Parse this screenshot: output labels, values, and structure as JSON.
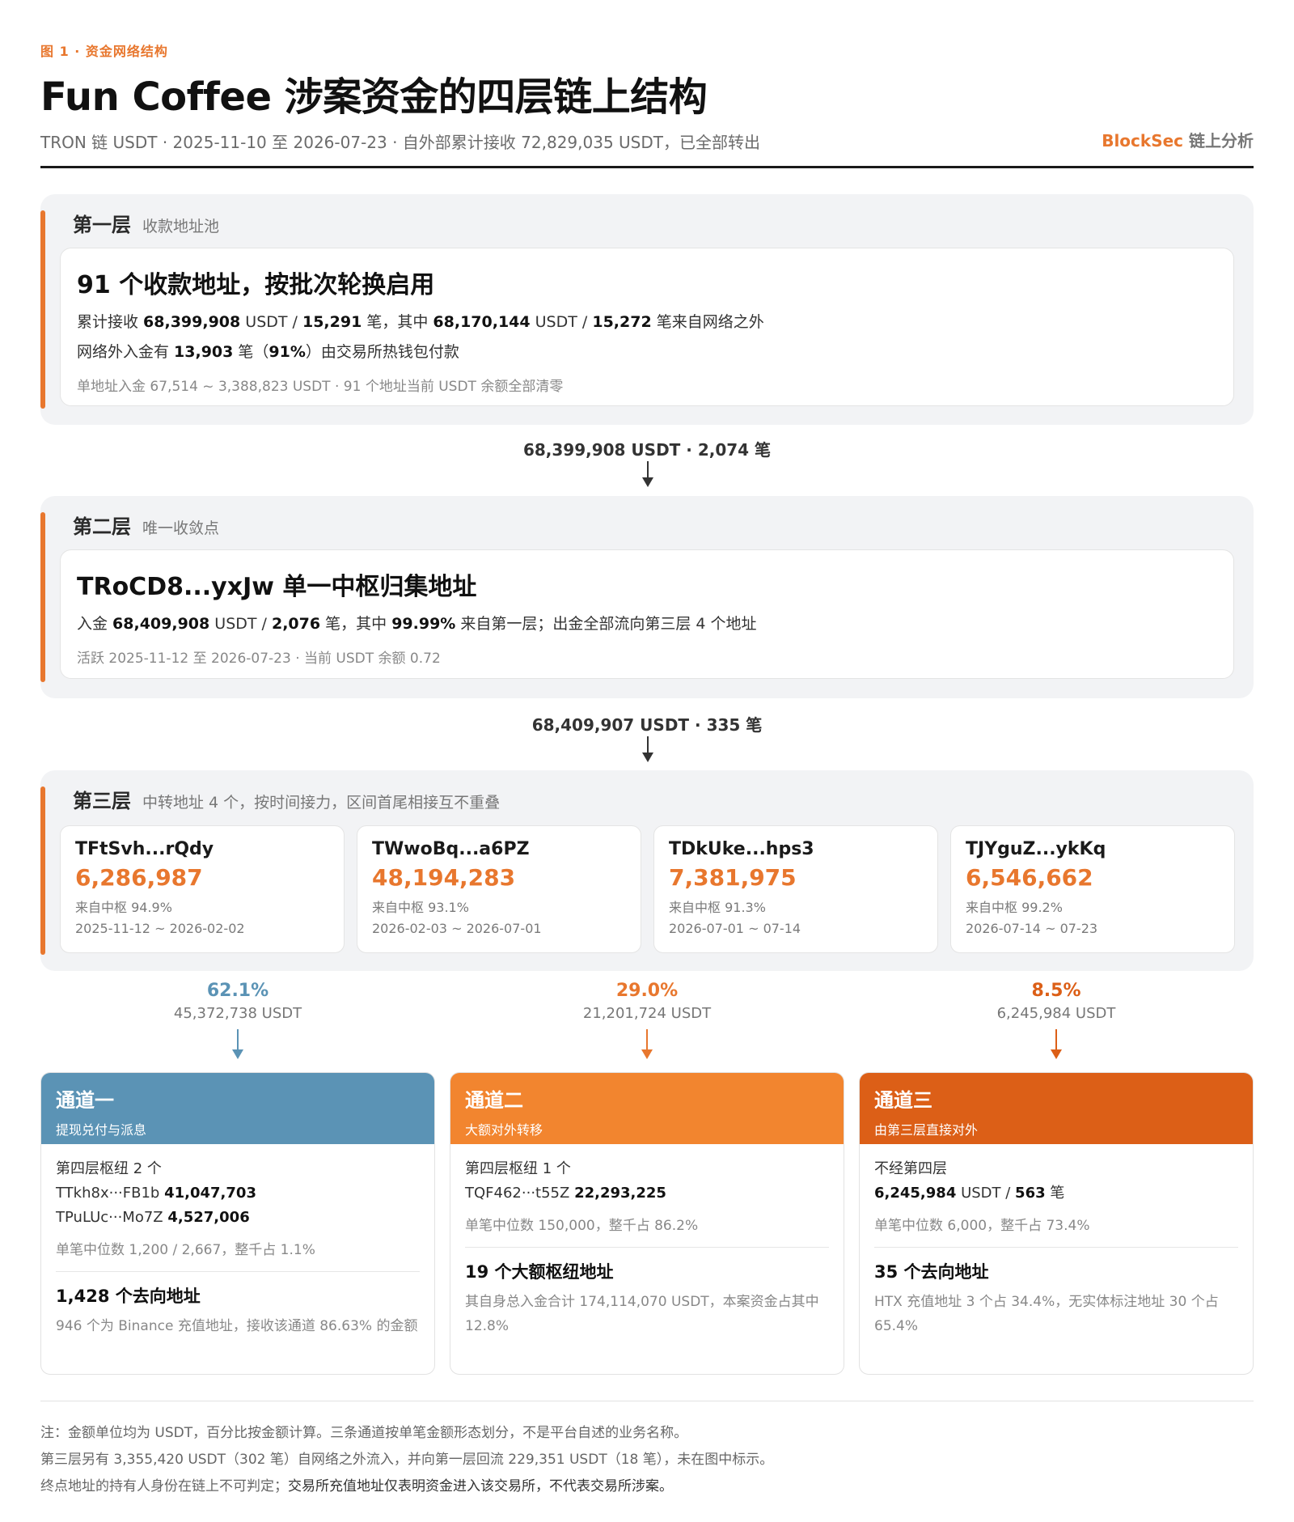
{
  "header": {
    "eyebrow": "图 1 · 资金网络结构",
    "title": "Fun Coffee 涉案资金的四层链上结构",
    "subtitle": "TRON 链 USDT · 2025-11-10 至 2026-07-23 · 自外部累计接收 72,829,035 USDT，已全部转出",
    "brand_name": "BlockSec",
    "brand_suffix": "链上分析"
  },
  "colors": {
    "accent": "#e8772e",
    "channel1": "#5b93b5",
    "channel2": "#f2852f",
    "channel3": "#dc5f17"
  },
  "layer1": {
    "name": "第一层",
    "desc": "收款地址池",
    "card_title": "91 个收款地址，按批次轮换启用",
    "line1": {
      "a": "累计接收 ",
      "v1": "68,399,908",
      "b": " USDT / ",
      "v2": "15,291",
      "c": " 笔，其中 ",
      "v3": "68,170,144",
      "d": " USDT / ",
      "v4": "15,272",
      "e": " 笔来自网络之外"
    },
    "line2": {
      "a": "网络外入金有 ",
      "v1": "13,903",
      "b": " 笔（",
      "v2": "91%",
      "c": "）由交易所热钱包付款"
    },
    "meta": "单地址入金 67,514 ~ 3,388,823 USDT · 91 个地址当前 USDT 余额全部清零"
  },
  "flow1": "68,399,908 USDT · 2,074 笔",
  "layer2": {
    "name": "第二层",
    "desc": "唯一收敛点",
    "card_title": "TRoCD8...yxJw 单一中枢归集地址",
    "line1": {
      "a": "入金 ",
      "v1": "68,409,908",
      "b": " USDT / ",
      "v2": "2,076",
      "c": " 笔，其中 ",
      "v3": "99.99%",
      "d": " 来自第一层；出金全部流向第三层 4 个地址"
    },
    "meta": "活跃 2025-11-12 至 2026-07-23 · 当前 USDT 余额 0.72"
  },
  "flow2": "68,409,907 USDT · 335 笔",
  "layer3": {
    "name": "第三层",
    "desc": "中转地址 4 个，按时间接力，区间首尾相接互不重叠",
    "relays": [
      {
        "addr": "TFtSvh...rQdy",
        "amount": "6,286,987",
        "share": "来自中枢 94.9%",
        "period": "2025-11-12 ~ 2026-02-02"
      },
      {
        "addr": "TWwoBq...a6PZ",
        "amount": "48,194,283",
        "share": "来自中枢 93.1%",
        "period": "2026-02-03 ~ 2026-07-01"
      },
      {
        "addr": "TDkUke...hps3",
        "amount": "7,381,975",
        "share": "来自中枢 91.3%",
        "period": "2026-07-01 ~ 07-14"
      },
      {
        "addr": "TJYguZ...ykKq",
        "amount": "6,546,662",
        "share": "来自中枢 99.2%",
        "period": "2026-07-14 ~ 07-23"
      }
    ]
  },
  "splits": [
    {
      "pct": "62.1%",
      "amount": "45,372,738 USDT"
    },
    {
      "pct": "29.0%",
      "amount": "21,201,724 USDT"
    },
    {
      "pct": "8.5%",
      "amount": "6,245,984 USDT"
    }
  ],
  "channels": [
    {
      "title": "通道一",
      "subtitle": "提现兑付与派息",
      "l1": "第四层枢纽 2 个",
      "l2": {
        "addr": "TTkh8x···FB1b",
        "val": "41,047,703"
      },
      "l3": {
        "addr": "TPuLUc···Mo7Z",
        "val": "4,527,006"
      },
      "meta": "单笔中位数 1,200 / 2,667，整千占 1.1%",
      "big": "1,428 个去向地址",
      "desc": "946 个为 Binance 充值地址，接收该通道 86.63% 的金额"
    },
    {
      "title": "通道二",
      "subtitle": "大额对外转移",
      "l1": "第四层枢纽 1 个",
      "l2": {
        "addr": "TQF462···t55Z",
        "val": "22,293,225"
      },
      "meta": "单笔中位数 150,000，整千占 86.2%",
      "big": "19 个大额枢纽地址",
      "desc": "其自身总入金合计 174,114,070 USDT，本案资金占其中 12.8%"
    },
    {
      "title": "通道三",
      "subtitle": "由第三层直接对外",
      "l1": "不经第四层",
      "l2": {
        "val": "6,245,984",
        "mid": " USDT / ",
        "val2": "563",
        "tail": " 笔"
      },
      "meta": "单笔中位数 6,000，整千占 73.4%",
      "big": "35 个去向地址",
      "desc": "HTX 充值地址 3 个占 34.4%，无实体标注地址 30 个占 65.4%"
    }
  ],
  "notes": {
    "n1": "注：金额单位均为 USDT，百分比按金额计算。三条通道按单笔金额形态划分，不是平台自述的业务名称。",
    "n2": "第三层另有 3,355,420 USDT（302 笔）自网络之外流入，并向第一层回流 229,351 USDT（18 笔），未在图中标示。",
    "n3a": "终点地址的持有人身份在链上不可判定；",
    "n3b": "交易所充值地址仅表明资金进入该交易所，不代表交易所涉案。"
  }
}
